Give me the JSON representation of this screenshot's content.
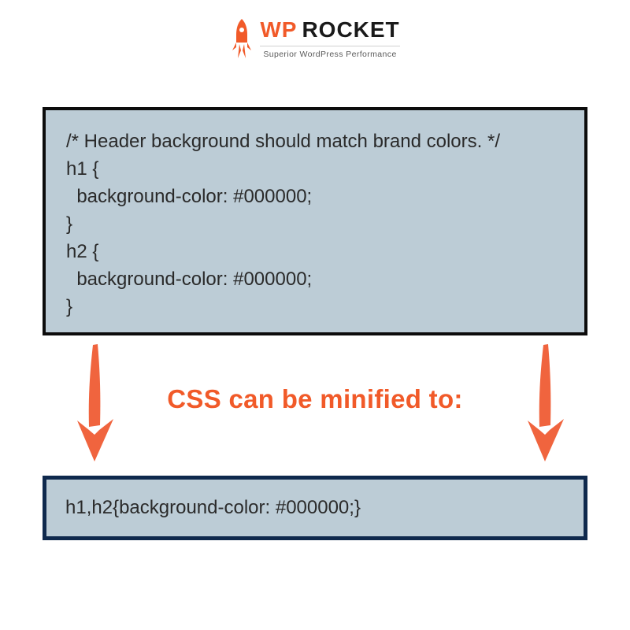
{
  "logo": {
    "wp": "WP",
    "rocket": "ROCKET",
    "tagline": "Superior WordPress Performance"
  },
  "code_before": "/* Header background should match brand colors. */\nh1 {\n  background-color: #000000;\n}\nh2 {\n  background-color: #000000;\n}",
  "caption": "CSS can be minified to:",
  "code_after": "h1,h2{background-color: #000000;}",
  "colors": {
    "accent": "#f15a29",
    "box_bg": "#bcccd6",
    "border_dark": "#0f294d"
  }
}
